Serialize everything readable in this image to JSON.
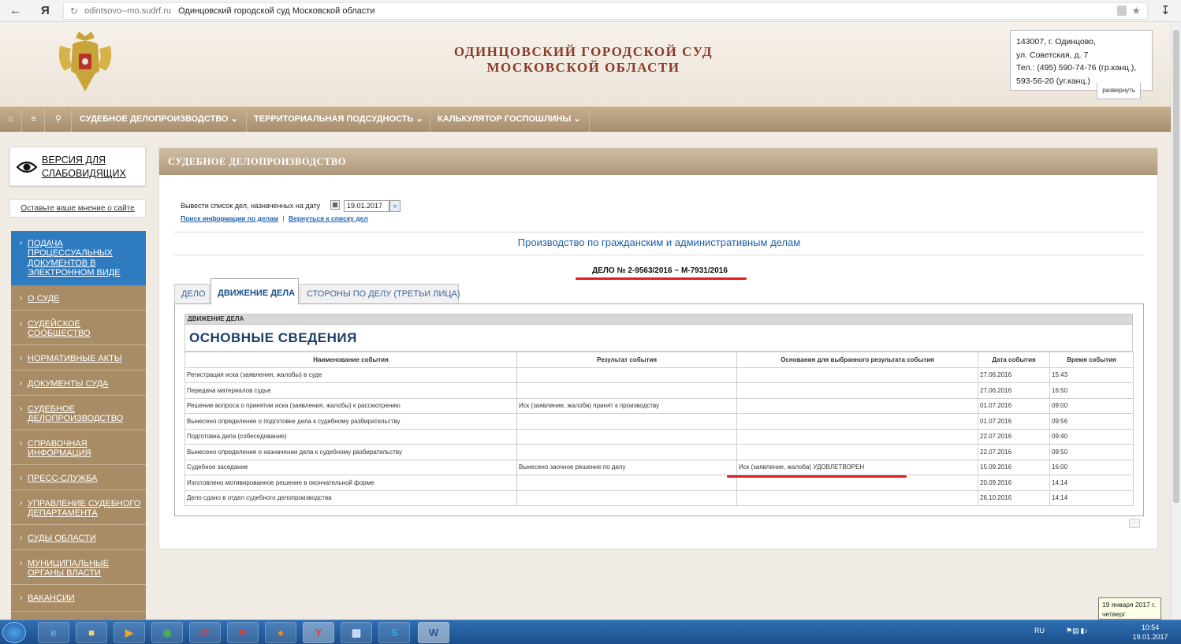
{
  "browser": {
    "url_domain": "odintsovo--mo.sudrf.ru",
    "page_title": "Одинцовский городской суд Московской области"
  },
  "header": {
    "court_line1": "ОДИНЦОВСКИЙ ГОРОДСКОЙ СУД",
    "court_line2": "МОСКОВСКОЙ ОБЛАСТИ",
    "address": [
      "143007, г. Одинцово,",
      "ул. Советская, д. 7",
      "Тел.: (495) 590-74-76 (гр.канц.),",
      "593-56-20 (уг.канц.)"
    ],
    "address_toggle": "развернуть"
  },
  "nav": {
    "items": [
      "СУДЕБНОЕ ДЕЛОПРОИЗВОДСТВО",
      "ТЕРРИТОРИАЛЬНАЯ ПОДСУДНОСТЬ",
      "КАЛЬКУЛЯТОР ГОСПОШЛИНЫ"
    ]
  },
  "sidebar": {
    "eye_line1": "ВЕРСИЯ ДЛЯ",
    "eye_line2": "СЛАБОВИДЯЩИХ",
    "feedback": "Оставьте ваше мнение о сайте",
    "menu": [
      [
        "ПОДАЧА",
        "ПРОЦЕССУАЛЬНЫХ",
        "ДОКУМЕНТОВ В",
        "ЭЛЕКТРОННОМ ВИДЕ"
      ],
      [
        "О СУДЕ"
      ],
      [
        "СУДЕЙСКОЕ",
        "СООБЩЕСТВО"
      ],
      [
        "НОРМАТИВНЫЕ АКТЫ"
      ],
      [
        "ДОКУМЕНТЫ СУДА"
      ],
      [
        "СУДЕБНОЕ",
        "ДЕЛОПРОИЗВОДСТВО"
      ],
      [
        "СПРАВОЧНАЯ",
        "ИНФОРМАЦИЯ"
      ],
      [
        "ПРЕСС-СЛУЖБА"
      ],
      [
        "УПРАВЛЕНИЕ СУДЕБНОГО",
        "ДЕПАРТАМЕНТА"
      ],
      [
        "СУДЫ ОБЛАСТИ"
      ],
      [
        "МУНИЦИПАЛЬНЫЕ",
        "ОРГАНЫ ВЛАСТИ"
      ],
      [
        "ВАКАНСИИ"
      ]
    ]
  },
  "main": {
    "title": "СУДЕБНОЕ ДЕЛОПРОИЗВОДСТВО",
    "date_prompt": "Вывести список дел, назначенных на дату",
    "date_value": "19.01.2017",
    "link_search": "Поиск информации по делам",
    "link_sep": "|",
    "link_back": "Вернуться к списку дел",
    "production_title": "Производство по гражданским и административным делам",
    "case_number": "ДЕЛО № 2-9563/2016 ~ М-7931/2016",
    "tabs": [
      "ДЕЛО",
      "ДВИЖЕНИЕ ДЕЛА",
      "СТОРОНЫ ПО ДЕЛУ (ТРЕТЬИ ЛИЦА)"
    ],
    "movement_label": "ДВИЖЕНИЕ ДЕЛА",
    "basic_info": "ОСНОВНЫЕ СВЕДЕНИЯ",
    "table": {
      "headers": [
        "Наименование события",
        "Результат события",
        "Основания для выбранного результата события",
        "Дата события",
        "Время события"
      ],
      "rows": [
        [
          "Регистрация иска (заявления, жалобы) в суде",
          "",
          "",
          "27.06.2016",
          "15:43"
        ],
        [
          "Передача материалов судье",
          "",
          "",
          "27.06.2016",
          "16:50"
        ],
        [
          "Решение вопроса о принятии иска (заявления, жалобы) к рассмотрению",
          "Иск (заявление, жалоба) принят к производству",
          "",
          "01.07.2016",
          "09:00"
        ],
        [
          "Вынесено определение о подготовке дела к судебному разбирательству",
          "",
          "",
          "01.07.2016",
          "09:56"
        ],
        [
          "Подготовка дела (собеседование)",
          "",
          "",
          "22.07.2016",
          "09:40"
        ],
        [
          "Вынесено определение о назначении дела к судебному разбирательству",
          "",
          "",
          "22.07.2016",
          "09:50"
        ],
        [
          "Судебное заседание",
          "Вынесено заочное решение по делу",
          "Иск (заявление, жалоба) УДОВЛЕТВОРЕН",
          "15.09.2016",
          "16:00"
        ],
        [
          "Изготовлено мотивированное решение в окончательной форме",
          "",
          "",
          "20.09.2016",
          "14:14"
        ],
        [
          "Дело сдано в отдел судебного делопроизводства",
          "",
          "",
          "26.10.2016",
          "14:14"
        ]
      ]
    }
  },
  "taskbar": {
    "lang": "RU",
    "time": "10:54",
    "date": "19.01.2017",
    "tooltip_line1": "19 января 2017 г.",
    "tooltip_line2": "четверг"
  },
  "colors": {
    "nav_brown": "#a88f6e",
    "court_red": "#8b3a2a",
    "link_blue": "#1f5fa8",
    "active_blue": "#2e7bbf",
    "annotation_red": "#e21d1d"
  }
}
